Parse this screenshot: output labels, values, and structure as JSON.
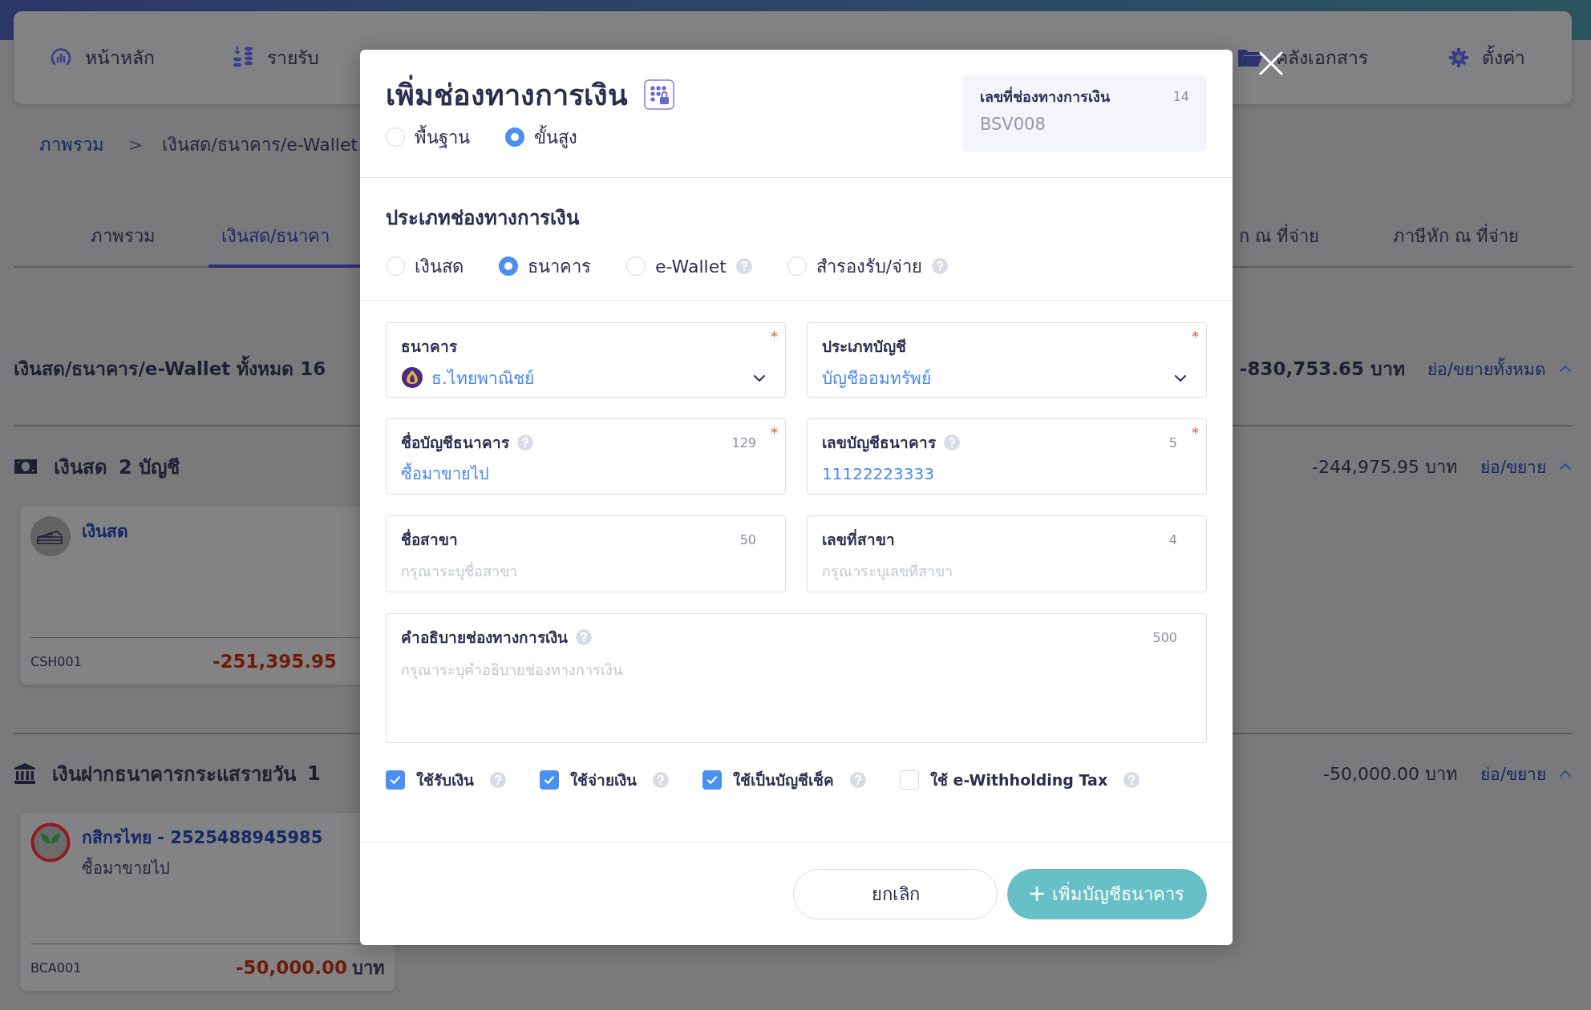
{
  "top_nav": {
    "left": [
      {
        "label": "หน้าหลัก"
      },
      {
        "label": "รายรับ"
      }
    ],
    "right": [
      {
        "label": "คลังเอกสาร"
      },
      {
        "label": "ตั้งค่า"
      }
    ]
  },
  "breadcrumb": {
    "items": [
      "ภาพรวม",
      "เงินสด/ธนาคาร/e-Wallet"
    ],
    "separator": ">"
  },
  "tabs": {
    "left": [
      {
        "label": "ภาพรวม",
        "selected": false
      },
      {
        "label": "เงินสด/ธนาคา",
        "selected": true
      }
    ],
    "right": [
      {
        "label": "ก ณ ที่จ่าย",
        "selected": false
      },
      {
        "label": "ภาษีหัก ณ ที่จ่าย",
        "selected": false
      }
    ]
  },
  "summary": {
    "title": "เงินสด/ธนาคาร/e-Wallet ทั้งหมด 16",
    "total": "-830,753.65 บาท",
    "toggle": "ย่อ/ขยายทั้งหมด",
    "expanded": true
  },
  "groups": [
    {
      "title": "เงินสด",
      "count": "2 บัญชี",
      "total": "-244,975.95 บาท",
      "toggle": "ย่อ/ขยาย",
      "expanded": true,
      "card": {
        "name": "เงินสด",
        "code": "CSH001",
        "amount": "-251,395.95"
      }
    },
    {
      "title": "เงินฝากธนาคารกระแสรายวัน",
      "count": "1",
      "total": "-50,000.00 บาท",
      "toggle": "ย่อ/ขยาย",
      "expanded": true,
      "card": {
        "name": "กสิกรไทย - 2525488945985",
        "subtitle": "ซื้อมาขายไป",
        "code": "BCA001",
        "amount": "-50,000.00",
        "currency": "บาท"
      }
    }
  ],
  "modal": {
    "title": "เพิ่มช่องทางการเงิน",
    "mode_options": [
      {
        "label": "พื้นฐาน",
        "selected": false
      },
      {
        "label": "ขั้นสูง",
        "selected": true
      }
    ],
    "code_box": {
      "label": "เลขที่ช่องทางการเงิน",
      "counter": "14",
      "value": "BSV008"
    },
    "type_section": {
      "title": "ประเภทช่องทางการเงิน",
      "options": [
        {
          "label": "เงินสด",
          "selected": false,
          "help": false
        },
        {
          "label": "ธนาคาร",
          "selected": true,
          "help": false
        },
        {
          "label": "e-Wallet",
          "selected": false,
          "help": true
        },
        {
          "label": "สำรองรับ/จ่าย",
          "selected": false,
          "help": true
        }
      ]
    },
    "fields": [
      {
        "kind": "select",
        "label": "ธนาคาร",
        "required_mark": "*",
        "logo": true,
        "value": "ธ.ไทยพาณิชย์"
      },
      {
        "kind": "select",
        "label": "ประเภทบัญชี",
        "required_mark": "*",
        "value": "บัญชีออมทรัพย์"
      },
      {
        "kind": "text",
        "label": "ชื่อบัญชีธนาคาร",
        "help": true,
        "counter": "129",
        "required_mark": "*",
        "value": "ซื้อมาขายไป"
      },
      {
        "kind": "text",
        "label": "เลขบัญชีธนาคาร",
        "help": true,
        "counter": "5",
        "required_mark": "*",
        "value": "11122223333"
      },
      {
        "kind": "text",
        "label": "ชื่อสาขา",
        "counter": "50",
        "placeholder": "กรุณาระบุชื่อสาขา"
      },
      {
        "kind": "text",
        "label": "เลขที่สาขา",
        "counter": "4",
        "placeholder": "กรุณาระบุเลขที่สาขา"
      },
      {
        "kind": "textarea",
        "label": "คำอธิบายช่องทางการเงิน",
        "help": true,
        "counter": "500",
        "placeholder": "กรุณาระบุคำอธิบายช่องทางการเงิน"
      }
    ],
    "checkboxes": [
      {
        "label": "ใช้รับเงิน",
        "checked": true,
        "help": true
      },
      {
        "label": "ใช้จ่ายเงิน",
        "checked": true,
        "help": true
      },
      {
        "label": "ใช้เป็นบัญชีเช็ค",
        "checked": true,
        "help": true
      },
      {
        "label": "ใช้ e-Withholding Tax",
        "checked": false,
        "help": true
      }
    ],
    "buttons": {
      "cancel": "ยกเลิก",
      "submit": "เพิ่มบัญชีธนาคาร"
    }
  }
}
